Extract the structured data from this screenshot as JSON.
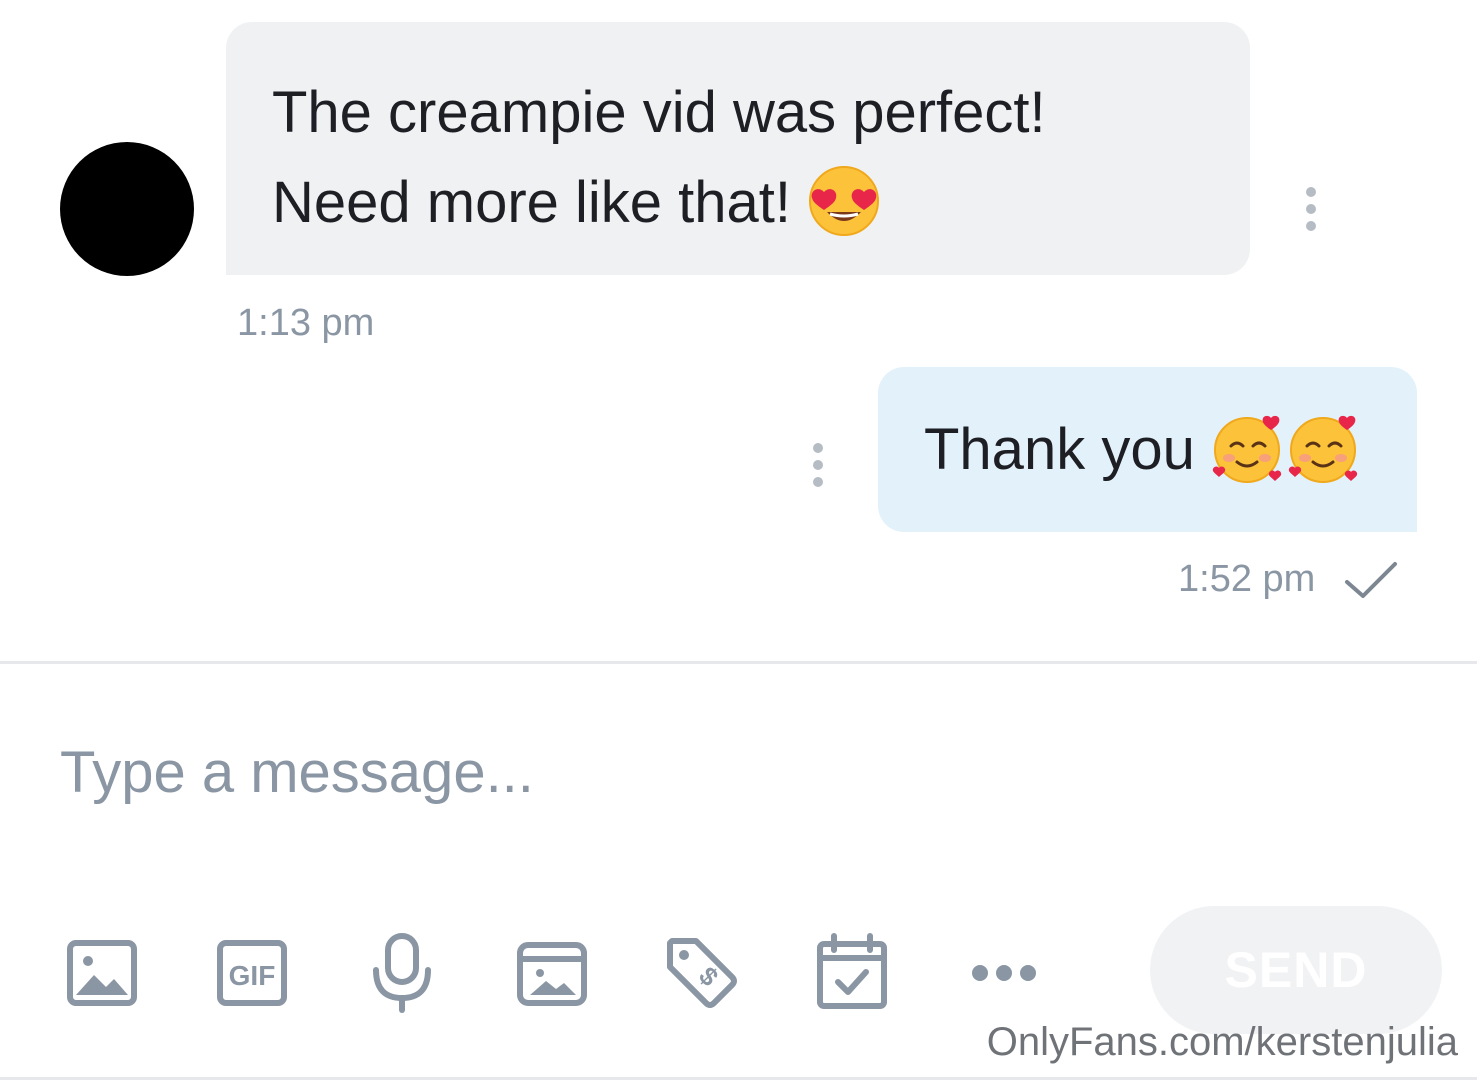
{
  "conversation": {
    "incoming": {
      "line1": "The creampie vid was perfect!",
      "line2": "Need more like that!",
      "emoji": "smiling-face-with-heart-eyes",
      "time": "1:13 pm"
    },
    "outgoing": {
      "text": "Thank you",
      "emoji": "smiling-face-with-hearts",
      "emoji_count": 2,
      "time": "1:52 pm",
      "status": "sent"
    }
  },
  "composer": {
    "placeholder": "Type a message...",
    "value": "",
    "send_label": "SEND",
    "send_enabled": false,
    "tools": [
      "image-icon",
      "gif-icon",
      "microphone-icon",
      "vault-media-icon",
      "price-tag-icon",
      "schedule-calendar-icon",
      "more-options-icon"
    ]
  },
  "watermark": "OnlyFans.com/kerstenjulia",
  "colors": {
    "incoming_bubble": "#f0f1f3",
    "outgoing_bubble": "#e3f2fa",
    "muted_text": "#8a96a3",
    "icon_gray": "#8a96a3",
    "text": "#1e1f24"
  }
}
